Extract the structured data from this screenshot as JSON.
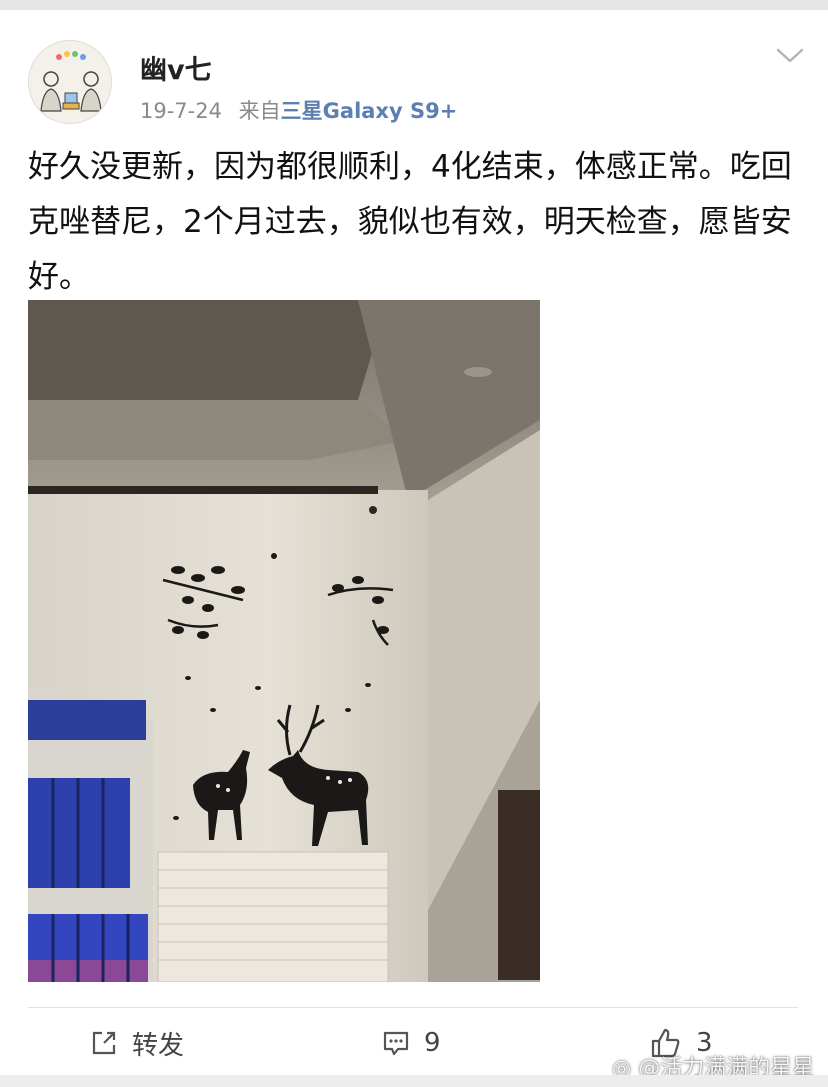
{
  "post": {
    "username": "幽v七",
    "date": "19-7-24",
    "source_prefix": "来自",
    "device": "三星Galaxy S9+",
    "text": "好久没更新，因为都很顺利，4化结束，体感正常。吃回克唑替尼，2个月过去，貌似也有效，明天检查，愿皆安好。"
  },
  "actions": {
    "repost_label": "转发",
    "comment_count": "9",
    "like_count": "3"
  },
  "watermark": "@活力满满的星星",
  "icons": {
    "menu": "chevron-down-icon",
    "repost": "share-icon",
    "comment": "comment-icon",
    "like": "thumbs-up-icon"
  },
  "colors": {
    "device_link": "#5b7fb0",
    "meta_gray": "#8a8a8a"
  }
}
